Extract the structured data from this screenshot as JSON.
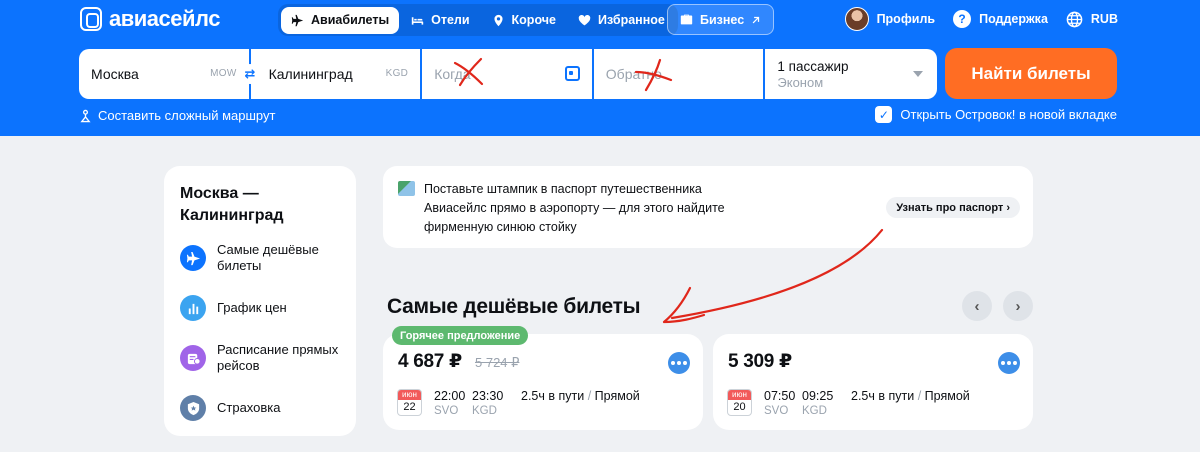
{
  "logo": {
    "text": "авиасейлс"
  },
  "nav": {
    "tabs": [
      {
        "label": "Авиабилеты",
        "active": true,
        "icon": "plane-icon"
      },
      {
        "label": "Отели",
        "active": false,
        "icon": "bed-icon"
      },
      {
        "label": "Короче",
        "active": false,
        "icon": "pin-icon"
      },
      {
        "label": "Избранное",
        "active": false,
        "icon": "heart-icon"
      }
    ],
    "business_label": "Бизнес",
    "profile_label": "Профиль",
    "support_label": "Поддержка",
    "currency_label": "RUB"
  },
  "search": {
    "from_value": "Москва",
    "from_code": "MOW",
    "to_value": "Калининград",
    "to_code": "KGD",
    "when_placeholder": "Когда",
    "back_placeholder": "Обратно",
    "passengers_label": "1 пассажир",
    "class_label": "Эконом",
    "submit_label": "Найти билеты",
    "complex_route_label": "Составить сложный маршрут",
    "ostrovok_label": "Открыть Островок! в новой вкладке",
    "ostrovok_checked": true
  },
  "sidebar": {
    "title": "Москва — Калининград",
    "items": [
      {
        "label": "Самые дешёвые билеты",
        "icon": "plane-icon",
        "color": "#0c73fe"
      },
      {
        "label": "График цен",
        "icon": "chart-icon",
        "color": "#3ba4f0"
      },
      {
        "label": "Расписание прямых рейсов",
        "icon": "schedule-icon",
        "color": "#a064e8"
      },
      {
        "label": "Страховка",
        "icon": "shield-icon",
        "color": "#5f7fa8"
      }
    ]
  },
  "promo": {
    "text": "Поставьте штампик в паспорт путешественника Авиасейлс прямо в аэропорту — для этого найдите фирменную синюю стойку",
    "button_label": "Узнать про паспорт ›"
  },
  "section": {
    "title": "Самые дешёвые билеты"
  },
  "tickets": [
    {
      "badge": "Горячее предложение",
      "price": "4 687 ₽",
      "old_price": "5 724 ₽",
      "month": "июн",
      "day": "22",
      "depart_time": "22:00",
      "arrive_time": "23:30",
      "depart_code": "SVO",
      "arrive_code": "KGD",
      "duration": "2.5ч в пути",
      "stops": "Прямой"
    },
    {
      "badge": "",
      "price": "5 309 ₽",
      "old_price": "",
      "month": "июн",
      "day": "20",
      "depart_time": "07:50",
      "arrive_time": "09:25",
      "depart_code": "SVO",
      "arrive_code": "KGD",
      "duration": "2.5ч в пути",
      "stops": "Прямой"
    }
  ],
  "colors": {
    "brand_blue": "#0c73fe",
    "cta_orange": "#ff6d23",
    "hot_green": "#5db96f",
    "annotation_red": "#e0271b"
  }
}
